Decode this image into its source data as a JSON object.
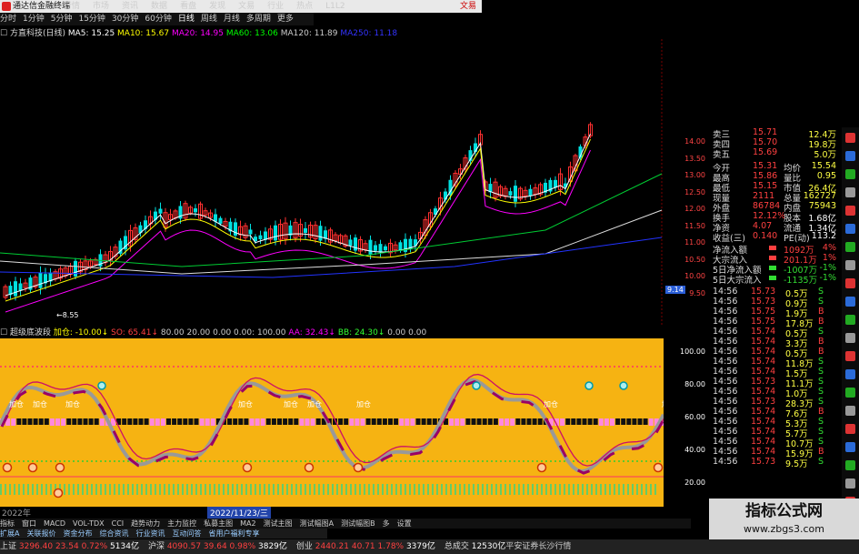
{
  "window": {
    "title": "通达信金融终端",
    "right_label": "文易"
  },
  "menu": [
    "行情",
    "市场",
    "资讯",
    "数据",
    "看盘",
    "发现",
    "文易",
    "行业",
    "热点",
    "L1L2"
  ],
  "periods": [
    "分时",
    "1分钟",
    "5分钟",
    "15分钟",
    "30分钟",
    "60分钟",
    "日线",
    "周线",
    "月线",
    "多周期",
    "更多"
  ],
  "ma_legend": {
    "stock": "方直科技(日线)",
    "items": [
      {
        "label": "MA5: 15.25",
        "color": "#ffffff"
      },
      {
        "label": "MA10: 15.67",
        "color": "#ffff00"
      },
      {
        "label": "MA20: 14.95",
        "color": "#ff00ff"
      },
      {
        "label": "MA60: 13.06",
        "color": "#00ff00"
      },
      {
        "label": "MA120: 11.89",
        "color": "#cccccc"
      },
      {
        "label": "MA250: 11.18",
        "color": "#3333ff"
      }
    ]
  },
  "main_chart": {
    "low_label": "8.55",
    "price_ticks": [
      "14.00",
      "13.50",
      "13.00",
      "12.50",
      "12.00",
      "11.50",
      "11.00",
      "10.50",
      "10.00",
      "9.50"
    ],
    "right_box": "9.14"
  },
  "indicator": {
    "title": "超级底波段",
    "params": [
      {
        "label": "加仓: -10.00↓",
        "color": "#ffff00"
      },
      {
        "label": "SO: 65.41↓",
        "color": "#ff4040"
      },
      {
        "label": "80.00",
        "color": "#cccccc"
      },
      {
        "label": "20.00",
        "color": "#cccccc"
      },
      {
        "label": "0.00",
        "color": "#cccccc"
      },
      {
        "label": "0.00: 100.00",
        "color": "#cccccc"
      },
      {
        "label": "AA: 32.43↓",
        "color": "#ff00ff"
      },
      {
        "label": "BB: 24.30↓",
        "color": "#33ff33"
      },
      {
        "label": "0.00",
        "color": "#cccccc"
      },
      {
        "label": "0.00",
        "color": "#cccccc"
      }
    ],
    "ticks": [
      "100.00",
      "80.00",
      "60.00",
      "40.00",
      "20.00"
    ],
    "signal_labels": [
      "加仓",
      "加仓",
      "加仓",
      "加仓",
      "加仓",
      "加仓",
      "加仓",
      "加仓",
      "加仓"
    ]
  },
  "date_bar": {
    "start": "2022年",
    "highlight": "2022/11/23/三"
  },
  "tabs": [
    "指标",
    "窗口",
    "MACD",
    "VOL-TDX",
    "CCI",
    "趋势动力",
    "主力监控",
    "私募主图",
    "MA2",
    "测试主图",
    "测试幅图A",
    "测试幅图B",
    "多",
    "设置"
  ],
  "news_tabs": [
    "扩展A",
    "关联报价",
    "资金分布",
    "综合资讯",
    "行业资讯",
    "互动问答",
    "省用户福利专享"
  ],
  "quote": {
    "orders": [
      {
        "label": "卖三",
        "price": "15.71",
        "vol": "12.4万"
      },
      {
        "label": "卖四",
        "price": "15.70",
        "vol": "19.8万"
      },
      {
        "label": "卖五",
        "price": "15.69",
        "vol": "5.0万"
      }
    ],
    "fields": [
      {
        "k1": "今开",
        "v1": "15.31",
        "k2": "均价",
        "v2": "15.54"
      },
      {
        "k1": "最高",
        "v1": "15.86",
        "k2": "量比",
        "v2": "0.95"
      },
      {
        "k1": "最低",
        "v1": "15.15",
        "k2": "市值",
        "v2": "26.4亿"
      },
      {
        "k1": "现量",
        "v1": "2111",
        "k2": "总量",
        "v2": "162727"
      },
      {
        "k1": "外盘",
        "v1": "86784",
        "k2": "内盘",
        "v2": "75943"
      },
      {
        "k1": "换手",
        "v1": "12.12%",
        "k2": "股本",
        "v2": "1.68亿"
      },
      {
        "k1": "净资",
        "v1": "4.07",
        "k2": "流通",
        "v2": "1.34亿"
      },
      {
        "k1": "收益(三)",
        "v1": "0.140",
        "k2": "PE(动)",
        "v2": "113.2"
      }
    ],
    "flows": [
      {
        "label": "净流入额",
        "value": "1092万",
        "pct": "4%",
        "color": "#ff4040"
      },
      {
        "label": "大宗流入",
        "value": "201.1万",
        "pct": "1%",
        "color": "#ff4040"
      },
      {
        "label": "5日净流入额",
        "value": "-1007万",
        "pct": "-1%",
        "color": "#33dd33"
      },
      {
        "label": "5日大宗流入",
        "value": "-1135万",
        "pct": "-1%",
        "color": "#33dd33"
      }
    ],
    "ticks": [
      {
        "time": "14:56",
        "price": "15.73",
        "vol": "0.5万",
        "side": "S"
      },
      {
        "time": "14:56",
        "price": "15.73",
        "vol": "0.9万",
        "side": "S"
      },
      {
        "time": "14:56",
        "price": "15.75",
        "vol": "1.9万",
        "side": "B"
      },
      {
        "time": "14:56",
        "price": "15.75",
        "vol": "17.8万",
        "side": "B"
      },
      {
        "time": "14:56",
        "price": "15.74",
        "vol": "0.5万",
        "side": "S"
      },
      {
        "time": "14:56",
        "price": "15.74",
        "vol": "3.3万",
        "side": "B"
      },
      {
        "time": "14:56",
        "price": "15.74",
        "vol": "0.5万",
        "side": "B"
      },
      {
        "time": "14:56",
        "price": "15.74",
        "vol": "11.8万",
        "side": "S"
      },
      {
        "time": "14:56",
        "price": "15.74",
        "vol": "1.5万",
        "side": "S"
      },
      {
        "time": "14:56",
        "price": "15.73",
        "vol": "11.1万",
        "side": "S"
      },
      {
        "time": "14:56",
        "price": "15.74",
        "vol": "1.0万",
        "side": "S"
      },
      {
        "time": "14:56",
        "price": "15.73",
        "vol": "28.3万",
        "side": "S"
      },
      {
        "time": "14:56",
        "price": "15.74",
        "vol": "7.6万",
        "side": "B"
      },
      {
        "time": "14:56",
        "price": "15.74",
        "vol": "5.3万",
        "side": "S"
      },
      {
        "time": "14:56",
        "price": "15.74",
        "vol": "5.7万",
        "side": "S"
      },
      {
        "time": "14:56",
        "price": "15.74",
        "vol": "10.7万",
        "side": "S"
      },
      {
        "time": "14:56",
        "price": "15.74",
        "vol": "15.9万",
        "side": "B"
      },
      {
        "time": "14:56",
        "price": "15.73",
        "vol": "9.5万",
        "side": "S"
      }
    ]
  },
  "status_bar": [
    {
      "name": "上证",
      "value": "3296.40",
      "change": "23.54",
      "pct": "0.72%",
      "amount": "5134亿"
    },
    {
      "name": "沪深",
      "value": "4090.57",
      "change": "39.64",
      "pct": "0.98%",
      "amount": "3829亿"
    },
    {
      "name": "创业",
      "value": "2440.21",
      "change": "40.71",
      "pct": "1.78%",
      "amount": "3379亿"
    }
  ],
  "status_extra": {
    "label": "总成交",
    "value": "12530亿",
    "news": "平安证券长沙行情"
  },
  "watermark": {
    "title": "指标公式网",
    "url": "www.zbgs3.com"
  },
  "colors": {
    "indicator_bg": "#f6b312",
    "bull": "#ff3030",
    "bear": "#00e0e0"
  }
}
